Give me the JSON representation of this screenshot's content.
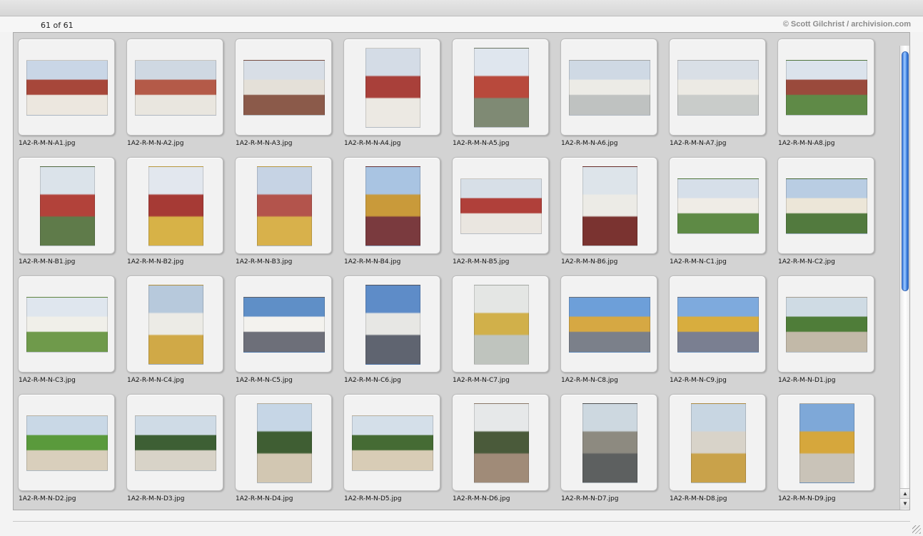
{
  "header": {
    "count": "61 of 61",
    "credit": "© Scott Gilchrist / archivision.com"
  },
  "scrollbar": {
    "up_icon": "▲",
    "down_icon": "▼"
  },
  "images": [
    {
      "name": "1A2-R-M-N-A1.jpg",
      "orientation": "landscape",
      "colors": [
        "#c9d6e6",
        "#a7473a",
        "#ece7df"
      ]
    },
    {
      "name": "1A2-R-M-N-A2.jpg",
      "orientation": "landscape",
      "colors": [
        "#cfd8e2",
        "#b45a48",
        "#e9e6df"
      ]
    },
    {
      "name": "1A2-R-M-N-A3.jpg",
      "orientation": "landscape",
      "colors": [
        "#d8dee6",
        "#e4e0d8",
        "#8b5a4a"
      ]
    },
    {
      "name": "1A2-R-M-N-A4.jpg",
      "orientation": "portrait",
      "colors": [
        "#d4dce6",
        "#a9403a",
        "#ece9e3"
      ]
    },
    {
      "name": "1A2-R-M-N-A5.jpg",
      "orientation": "portrait",
      "colors": [
        "#dfe6ee",
        "#b8493c",
        "#7f8a74"
      ]
    },
    {
      "name": "1A2-R-M-N-A6.jpg",
      "orientation": "landscape",
      "colors": [
        "#cfd9e4",
        "#ecebe6",
        "#bfc2c1"
      ]
    },
    {
      "name": "1A2-R-M-N-A7.jpg",
      "orientation": "landscape",
      "colors": [
        "#d9dfe6",
        "#eceae4",
        "#c9ccca"
      ]
    },
    {
      "name": "1A2-R-M-N-A8.jpg",
      "orientation": "landscape",
      "colors": [
        "#dbe3ec",
        "#9a4a3c",
        "#5f8a47"
      ]
    },
    {
      "name": "1A2-R-M-N-B1.jpg",
      "orientation": "portrait",
      "colors": [
        "#dbe3ea",
        "#b2423a",
        "#5f7b4a"
      ]
    },
    {
      "name": "1A2-R-M-N-B2.jpg",
      "orientation": "portrait",
      "colors": [
        "#e2e7ee",
        "#a63a35",
        "#d7b247"
      ]
    },
    {
      "name": "1A2-R-M-N-B3.jpg",
      "orientation": "portrait",
      "colors": [
        "#c6d3e4",
        "#b3544c",
        "#d8b14b"
      ]
    },
    {
      "name": "1A2-R-M-N-B4.jpg",
      "orientation": "portrait",
      "colors": [
        "#a9c4e2",
        "#c99a3a",
        "#7a3a3e"
      ]
    },
    {
      "name": "1A2-R-M-N-B5.jpg",
      "orientation": "landscape",
      "colors": [
        "#d7dfe7",
        "#b0403a",
        "#eae6e0"
      ]
    },
    {
      "name": "1A2-R-M-N-B6.jpg",
      "orientation": "portrait",
      "colors": [
        "#dde4ea",
        "#ecebe6",
        "#7a3330"
      ]
    },
    {
      "name": "1A2-R-M-N-C1.jpg",
      "orientation": "landscape",
      "colors": [
        "#d6dfe9",
        "#efece6",
        "#5e8a45"
      ]
    },
    {
      "name": "1A2-R-M-N-C2.jpg",
      "orientation": "landscape",
      "colors": [
        "#b9cde3",
        "#ece6d8",
        "#527a3e"
      ]
    },
    {
      "name": "1A2-R-M-N-C3.jpg",
      "orientation": "landscape",
      "colors": [
        "#dfe6ee",
        "#f0efe9",
        "#6f9a4b"
      ]
    },
    {
      "name": "1A2-R-M-N-C4.jpg",
      "orientation": "portrait",
      "colors": [
        "#b7c9dc",
        "#ecebe6",
        "#d0a947"
      ]
    },
    {
      "name": "1A2-R-M-N-C5.jpg",
      "orientation": "landscape",
      "colors": [
        "#5f8fc7",
        "#f3f2ee",
        "#6d6f79"
      ]
    },
    {
      "name": "1A2-R-M-N-C6.jpg",
      "orientation": "portrait",
      "colors": [
        "#5e8cc8",
        "#e7e7e4",
        "#5f6470"
      ]
    },
    {
      "name": "1A2-R-M-N-C7.jpg",
      "orientation": "portrait",
      "colors": [
        "#e4e6e4",
        "#d1b04a",
        "#bfc4be"
      ]
    },
    {
      "name": "1A2-R-M-N-C8.jpg",
      "orientation": "landscape",
      "colors": [
        "#6d9fd9",
        "#d6a843",
        "#7b808a"
      ]
    },
    {
      "name": "1A2-R-M-N-C9.jpg",
      "orientation": "landscape",
      "colors": [
        "#7eaadd",
        "#d8ad3e",
        "#7a7f91"
      ]
    },
    {
      "name": "1A2-R-M-N-D1.jpg",
      "orientation": "landscape",
      "colors": [
        "#cfdbe4",
        "#4f7d39",
        "#c2b9a8"
      ]
    },
    {
      "name": "1A2-R-M-N-D2.jpg",
      "orientation": "landscape",
      "colors": [
        "#c9d8e6",
        "#5a9a3c",
        "#d9cfbc"
      ]
    },
    {
      "name": "1A2-R-M-N-D3.jpg",
      "orientation": "landscape",
      "colors": [
        "#cfdbe6",
        "#3d5f34",
        "#d8d3c8"
      ]
    },
    {
      "name": "1A2-R-M-N-D4.jpg",
      "orientation": "portrait",
      "colors": [
        "#c6d6e6",
        "#3f5e33",
        "#d2c7b2"
      ]
    },
    {
      "name": "1A2-R-M-N-D5.jpg",
      "orientation": "landscape",
      "colors": [
        "#d4dfe9",
        "#456b34",
        "#d8ccb6"
      ]
    },
    {
      "name": "1A2-R-M-N-D6.jpg",
      "orientation": "portrait",
      "colors": [
        "#e6e8e9",
        "#4a5a3a",
        "#a08b78"
      ]
    },
    {
      "name": "1A2-R-M-N-D7.jpg",
      "orientation": "portrait",
      "colors": [
        "#cdd8e0",
        "#8d8a80",
        "#5d6060"
      ]
    },
    {
      "name": "1A2-R-M-N-D8.jpg",
      "orientation": "portrait",
      "colors": [
        "#c8d6e2",
        "#d8d3c9",
        "#c9a24a"
      ]
    },
    {
      "name": "1A2-R-M-N-D9.jpg",
      "orientation": "portrait",
      "colors": [
        "#7ea8d8",
        "#d6a73c",
        "#c9c3b8"
      ]
    }
  ]
}
